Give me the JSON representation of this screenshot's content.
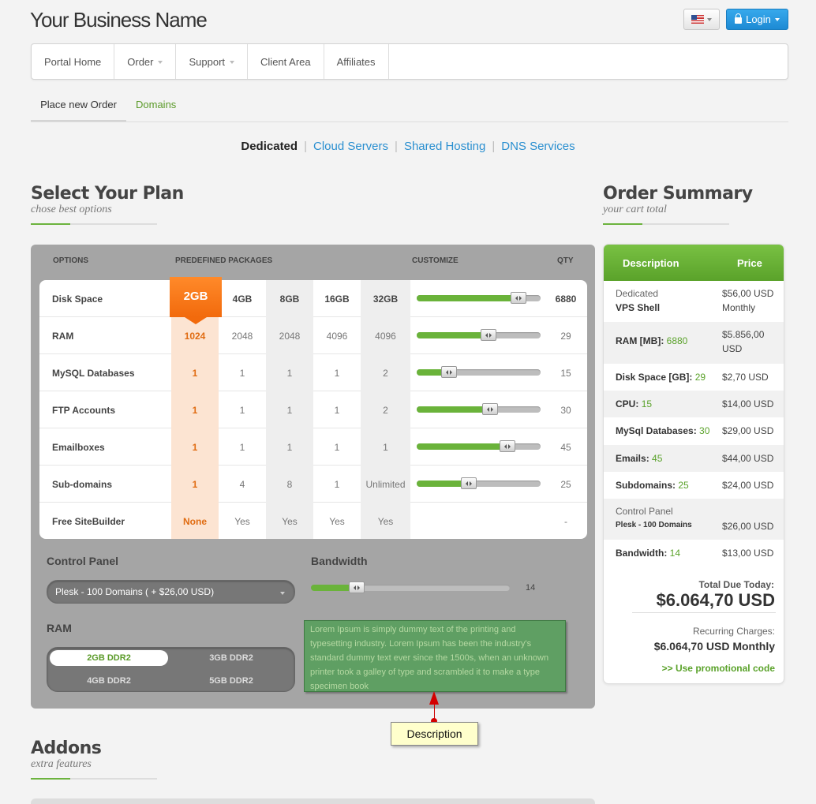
{
  "header": {
    "brand": "Your Business Name",
    "login_label": "Login"
  },
  "nav": {
    "items": [
      {
        "label": "Portal Home",
        "dropdown": false
      },
      {
        "label": "Order",
        "dropdown": true
      },
      {
        "label": "Support",
        "dropdown": true
      },
      {
        "label": "Client Area",
        "dropdown": false
      },
      {
        "label": "Affiliates",
        "dropdown": false
      }
    ]
  },
  "subtabs": {
    "place_order": "Place new Order",
    "domains": "Domains"
  },
  "categories": {
    "dedicated": "Dedicated",
    "cloud": "Cloud Servers",
    "shared": "Shared Hosting",
    "dns": "DNS Services",
    "separator": "|"
  },
  "plan_section": {
    "title": "Select Your Plan",
    "subtitle": "chose best options"
  },
  "summary_section": {
    "title": "Order Summary",
    "subtitle": "your cart total"
  },
  "addons_section": {
    "title": "Addons",
    "subtitle": "extra features"
  },
  "plan_table": {
    "headers": {
      "options": "OPTIONS",
      "packages": "PREDEFINED PACKAGES",
      "customize": "CUSTOMIZE",
      "qty": "QTY"
    },
    "packages": [
      "2GB",
      "4GB",
      "8GB",
      "16GB",
      "32GB"
    ],
    "disk_label": "Disk Space",
    "disk_qty": "6880",
    "disk_slider": 0.82,
    "rows": [
      {
        "label": "RAM",
        "values": [
          "1024",
          "2048",
          "2048",
          "4096",
          "4096"
        ],
        "qty": "29",
        "slider": 0.58
      },
      {
        "label": "MySQL Databases",
        "values": [
          "1",
          "1",
          "1",
          "1",
          "2"
        ],
        "qty": "15",
        "slider": 0.26
      },
      {
        "label": "FTP Accounts",
        "values": [
          "1",
          "1",
          "1",
          "1",
          "2"
        ],
        "qty": "30",
        "slider": 0.59
      },
      {
        "label": "Emailboxes",
        "values": [
          "1",
          "1",
          "1",
          "1",
          "1"
        ],
        "qty": "45",
        "slider": 0.73
      },
      {
        "label": "Sub-domains",
        "values": [
          "1",
          "4",
          "8",
          "1",
          "Unlimited"
        ],
        "qty": "25",
        "slider": 0.42
      },
      {
        "label": "Free SiteBuilder",
        "values": [
          "None",
          "Yes",
          "Yes",
          "Yes",
          "Yes"
        ],
        "qty": "-",
        "slider": null
      }
    ]
  },
  "control_panel": {
    "label": "Control Panel",
    "selected": "Plesk - 100 Domains ( + $26,00 USD)"
  },
  "bandwidth": {
    "label": "Bandwidth",
    "value": "14",
    "slider": 0.23
  },
  "ram": {
    "label": "RAM",
    "options": [
      "2GB DDR2",
      "3GB DDR2",
      "4GB DDR2",
      "5GB DDR2"
    ],
    "selected_index": 0
  },
  "description": {
    "text": "Lorem Ipsum is simply dummy text of the printing and typesetting industry. Lorem Ipsum has been the industry's standard dummy text ever since the 1500s, when an unknown printer took a galley of type and scrambled it to make a type specimen book",
    "callout": "Description"
  },
  "summary": {
    "head_description": "Description",
    "head_price": "Price",
    "rows": [
      {
        "label": "Dedicated",
        "label2": "VPS Shell",
        "value": "",
        "price": "$56,00 USD",
        "price2": "Monthly"
      },
      {
        "label": "RAM [MB]:",
        "value": "6880",
        "price": "$5.856,00",
        "price2": "USD"
      },
      {
        "label": "Disk Space [GB]:",
        "value": "29",
        "price": "$2,70 USD"
      },
      {
        "label": "CPU:",
        "value": "15",
        "price": "$14,00 USD"
      },
      {
        "label": "MySql Databases:",
        "value": "30",
        "price": "$29,00 USD"
      },
      {
        "label": "Emails:",
        "value": "45",
        "price": "$44,00 USD"
      },
      {
        "label": "Subdomains:",
        "value": "25",
        "price": "$24,00 USD"
      },
      {
        "label": "Control Panel",
        "label2": "Plesk - 100 Domains",
        "value": "",
        "price": "$26,00 USD"
      },
      {
        "label": "Bandwidth:",
        "value": "14",
        "price": "$13,00 USD"
      }
    ],
    "total_label": "Total Due Today:",
    "total_value": "$6.064,70 USD",
    "recurring_label": "Recurring Charges:",
    "recurring_value": "$6.064,70 USD Monthly",
    "promo_prefix": ">>",
    "promo_label": "Use promotional code"
  }
}
